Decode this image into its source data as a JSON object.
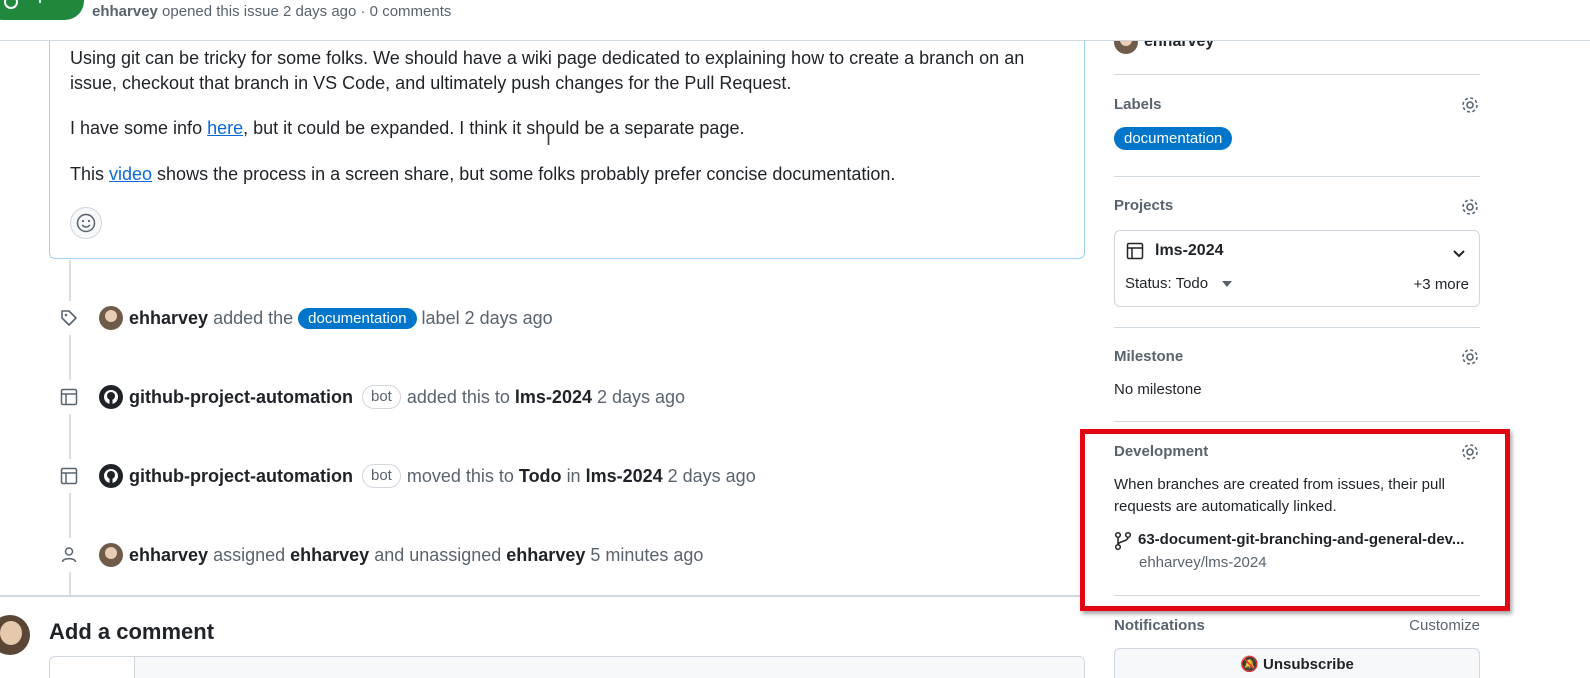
{
  "header": {
    "status_label": "Open",
    "author": "ehharvey",
    "meta_text": "opened this issue 2 days ago · 0 comments"
  },
  "comment": {
    "paragraph1": "Using git can be tricky for some folks. We should have a wiki page dedicated to explaining how to create a branch on an issue, checkout that branch in VS Code, and ultimately push changes for the Pull Request.",
    "p2_before": "I have some info ",
    "p2_link": "here",
    "p2_after": ", but it could be expanded. I think it should be a separate page.",
    "p3_before": "This ",
    "p3_link": "video",
    "p3_after": " shows the process in a screen share, but some folks probably prefer concise documentation."
  },
  "timeline": [
    {
      "actor": "ehharvey",
      "t1": "added the",
      "label": "documentation",
      "t2": "label 2 days ago"
    },
    {
      "actor": "github-project-automation",
      "bot": "bot",
      "t1": "added this to",
      "target": "lms-2024",
      "t2": "2 days ago"
    },
    {
      "actor": "github-project-automation",
      "bot": "bot",
      "t1": "moved this to",
      "status": "Todo",
      "t_in": "in",
      "target": "lms-2024",
      "t2": "2 days ago"
    },
    {
      "actor": "ehharvey",
      "t1": "assigned",
      "user1": "ehharvey",
      "t_and": "and unassigned",
      "user2": "ehharvey",
      "t2": "5 minutes ago"
    }
  ],
  "add_comment": {
    "title": "Add a comment"
  },
  "sidebar": {
    "assignee": "ehharvey",
    "labels": {
      "heading": "Labels",
      "value": "documentation"
    },
    "projects": {
      "heading": "Projects",
      "name": "lms-2024",
      "status": "Status: Todo",
      "more": "+3 more"
    },
    "milestone": {
      "heading": "Milestone",
      "value": "No milestone"
    },
    "development": {
      "heading": "Development",
      "text": "When branches are created from issues, their pull requests are automatically linked.",
      "branch": "63-document-git-branching-and-general-dev...",
      "repo": "ehharvey/lms-2024"
    },
    "notifications": {
      "heading": "Notifications",
      "customize": "Customize",
      "button": "Unsubscribe"
    }
  },
  "colors": {
    "label_blue": "#0075ca",
    "open_green": "#1f883d",
    "highlight_red": "#e30613",
    "link": "#0969da"
  }
}
